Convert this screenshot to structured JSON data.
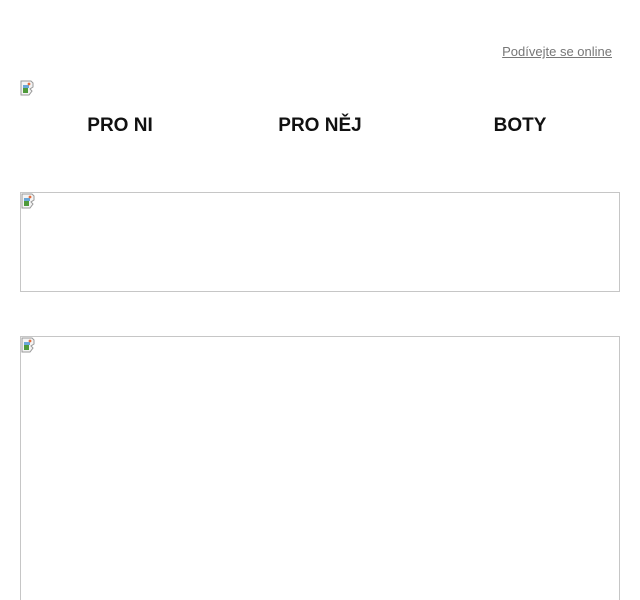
{
  "header": {
    "view_online_label": "Podívejte se online"
  },
  "logo": {
    "icon": "broken-image-icon"
  },
  "nav": {
    "items": [
      {
        "label": "PRO NI"
      },
      {
        "label": "PRO NĚJ"
      },
      {
        "label": "BOTY"
      }
    ]
  },
  "banners": [
    {
      "icon": "broken-image-icon"
    },
    {
      "icon": "broken-image-icon"
    }
  ],
  "colors": {
    "link": "#777777",
    "nav_text": "#111111",
    "border": "#c6c6c6"
  }
}
